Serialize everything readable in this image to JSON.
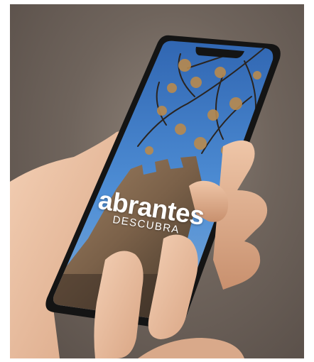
{
  "app": {
    "title": "abrantes",
    "subtitle": "DESCUBRA"
  },
  "colors": {
    "background": "#6f645c",
    "phone_body": "#141414",
    "sky": "#3d78c4",
    "stone": "#8a7058",
    "skin": "#e9bfa2"
  }
}
